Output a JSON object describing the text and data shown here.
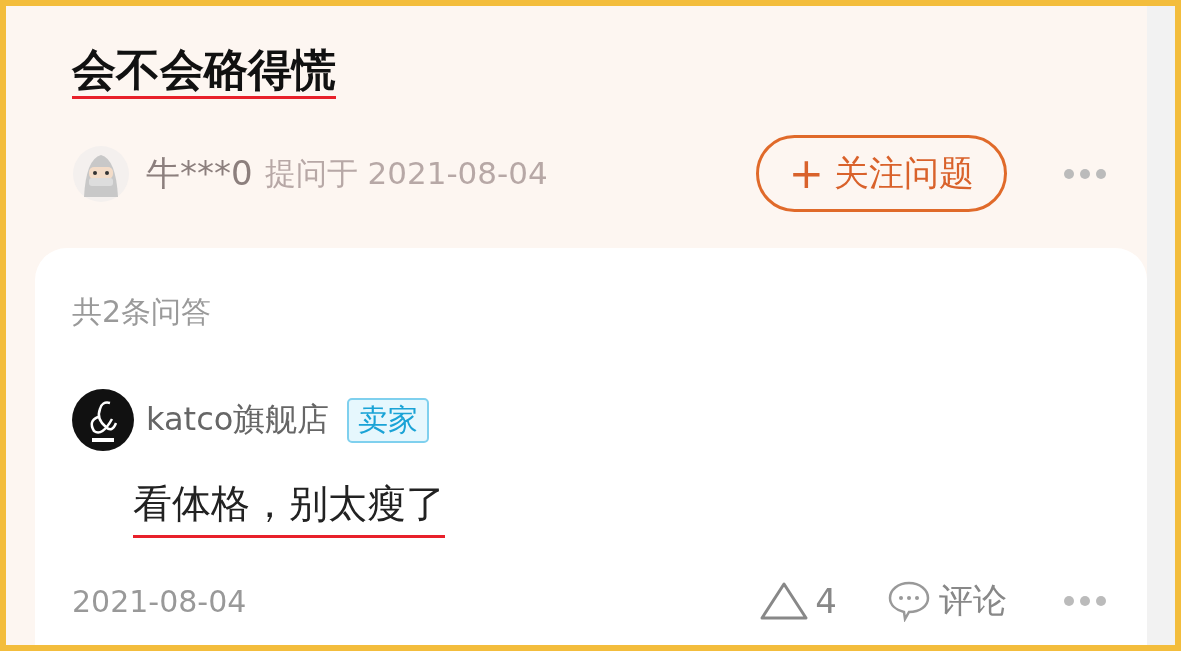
{
  "question": {
    "title": "会不会硌得慌",
    "asker": "牛***0",
    "asked_label": "提问于 2021-08-04",
    "follow_button": {
      "icon": "+",
      "label": "关注问题"
    }
  },
  "answers_card": {
    "count_label": "共2条问答",
    "answers": [
      {
        "author": "katco旗舰店",
        "badge": "卖家",
        "text": "看体格，别太瘦了",
        "date": "2021-08-04",
        "likes": "4",
        "comment_label": "评论"
      }
    ]
  }
}
